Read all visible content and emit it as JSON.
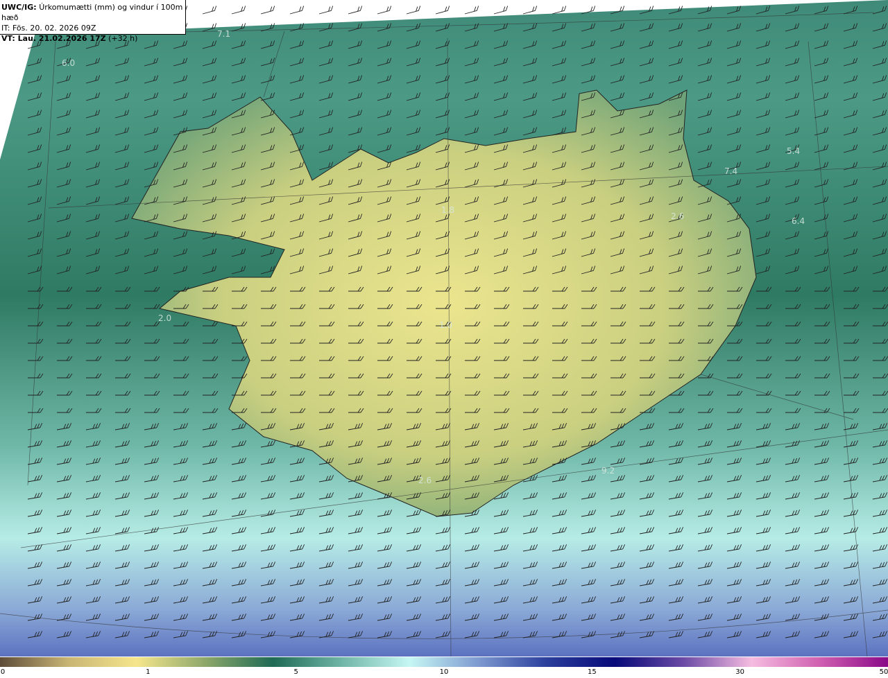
{
  "header": {
    "title_bold": "UWC/IG:",
    "title": "Úrkomumætti (mm) og vindur í 100m hæð",
    "issue_time": "IT: Fös. 20. 02. 2026 09Z",
    "valid_bold": "VT: Lau. 21.02.2026 17Z",
    "valid_offset": "(+32 h)"
  },
  "map_labels": [
    {
      "text": "7.1",
      "pos": "north-west sea"
    },
    {
      "text": "6.0",
      "pos": "west sea"
    },
    {
      "text": "5.4",
      "pos": "north-east sea"
    },
    {
      "text": "7.4",
      "pos": "north-east coast"
    },
    {
      "text": "6.4",
      "pos": "east sea"
    },
    {
      "text": "2.6",
      "pos": "east highlands"
    },
    {
      "text": "1.8",
      "pos": "north interior"
    },
    {
      "text": "2.0",
      "pos": "snaefellsnes"
    },
    {
      "text": "1.0",
      "pos": "hofsjokull"
    },
    {
      "text": "2.6",
      "pos": "south coast"
    },
    {
      "text": "9.2",
      "pos": "south-east sea"
    }
  ],
  "colorbar": {
    "ticks": [
      "0",
      "1",
      "5",
      "10",
      "15",
      "30",
      "50"
    ],
    "colors": [
      "#5e4c3a",
      "#c8b574",
      "#f5e68c",
      "#8ea86a",
      "#1e6a55",
      "#6fb5a6",
      "#c6f7f4",
      "#7e9ad0",
      "#2b3f9c",
      "#070a78",
      "#6a4aa5",
      "#f5bce0",
      "#d060b0",
      "#8a0a88"
    ]
  }
}
